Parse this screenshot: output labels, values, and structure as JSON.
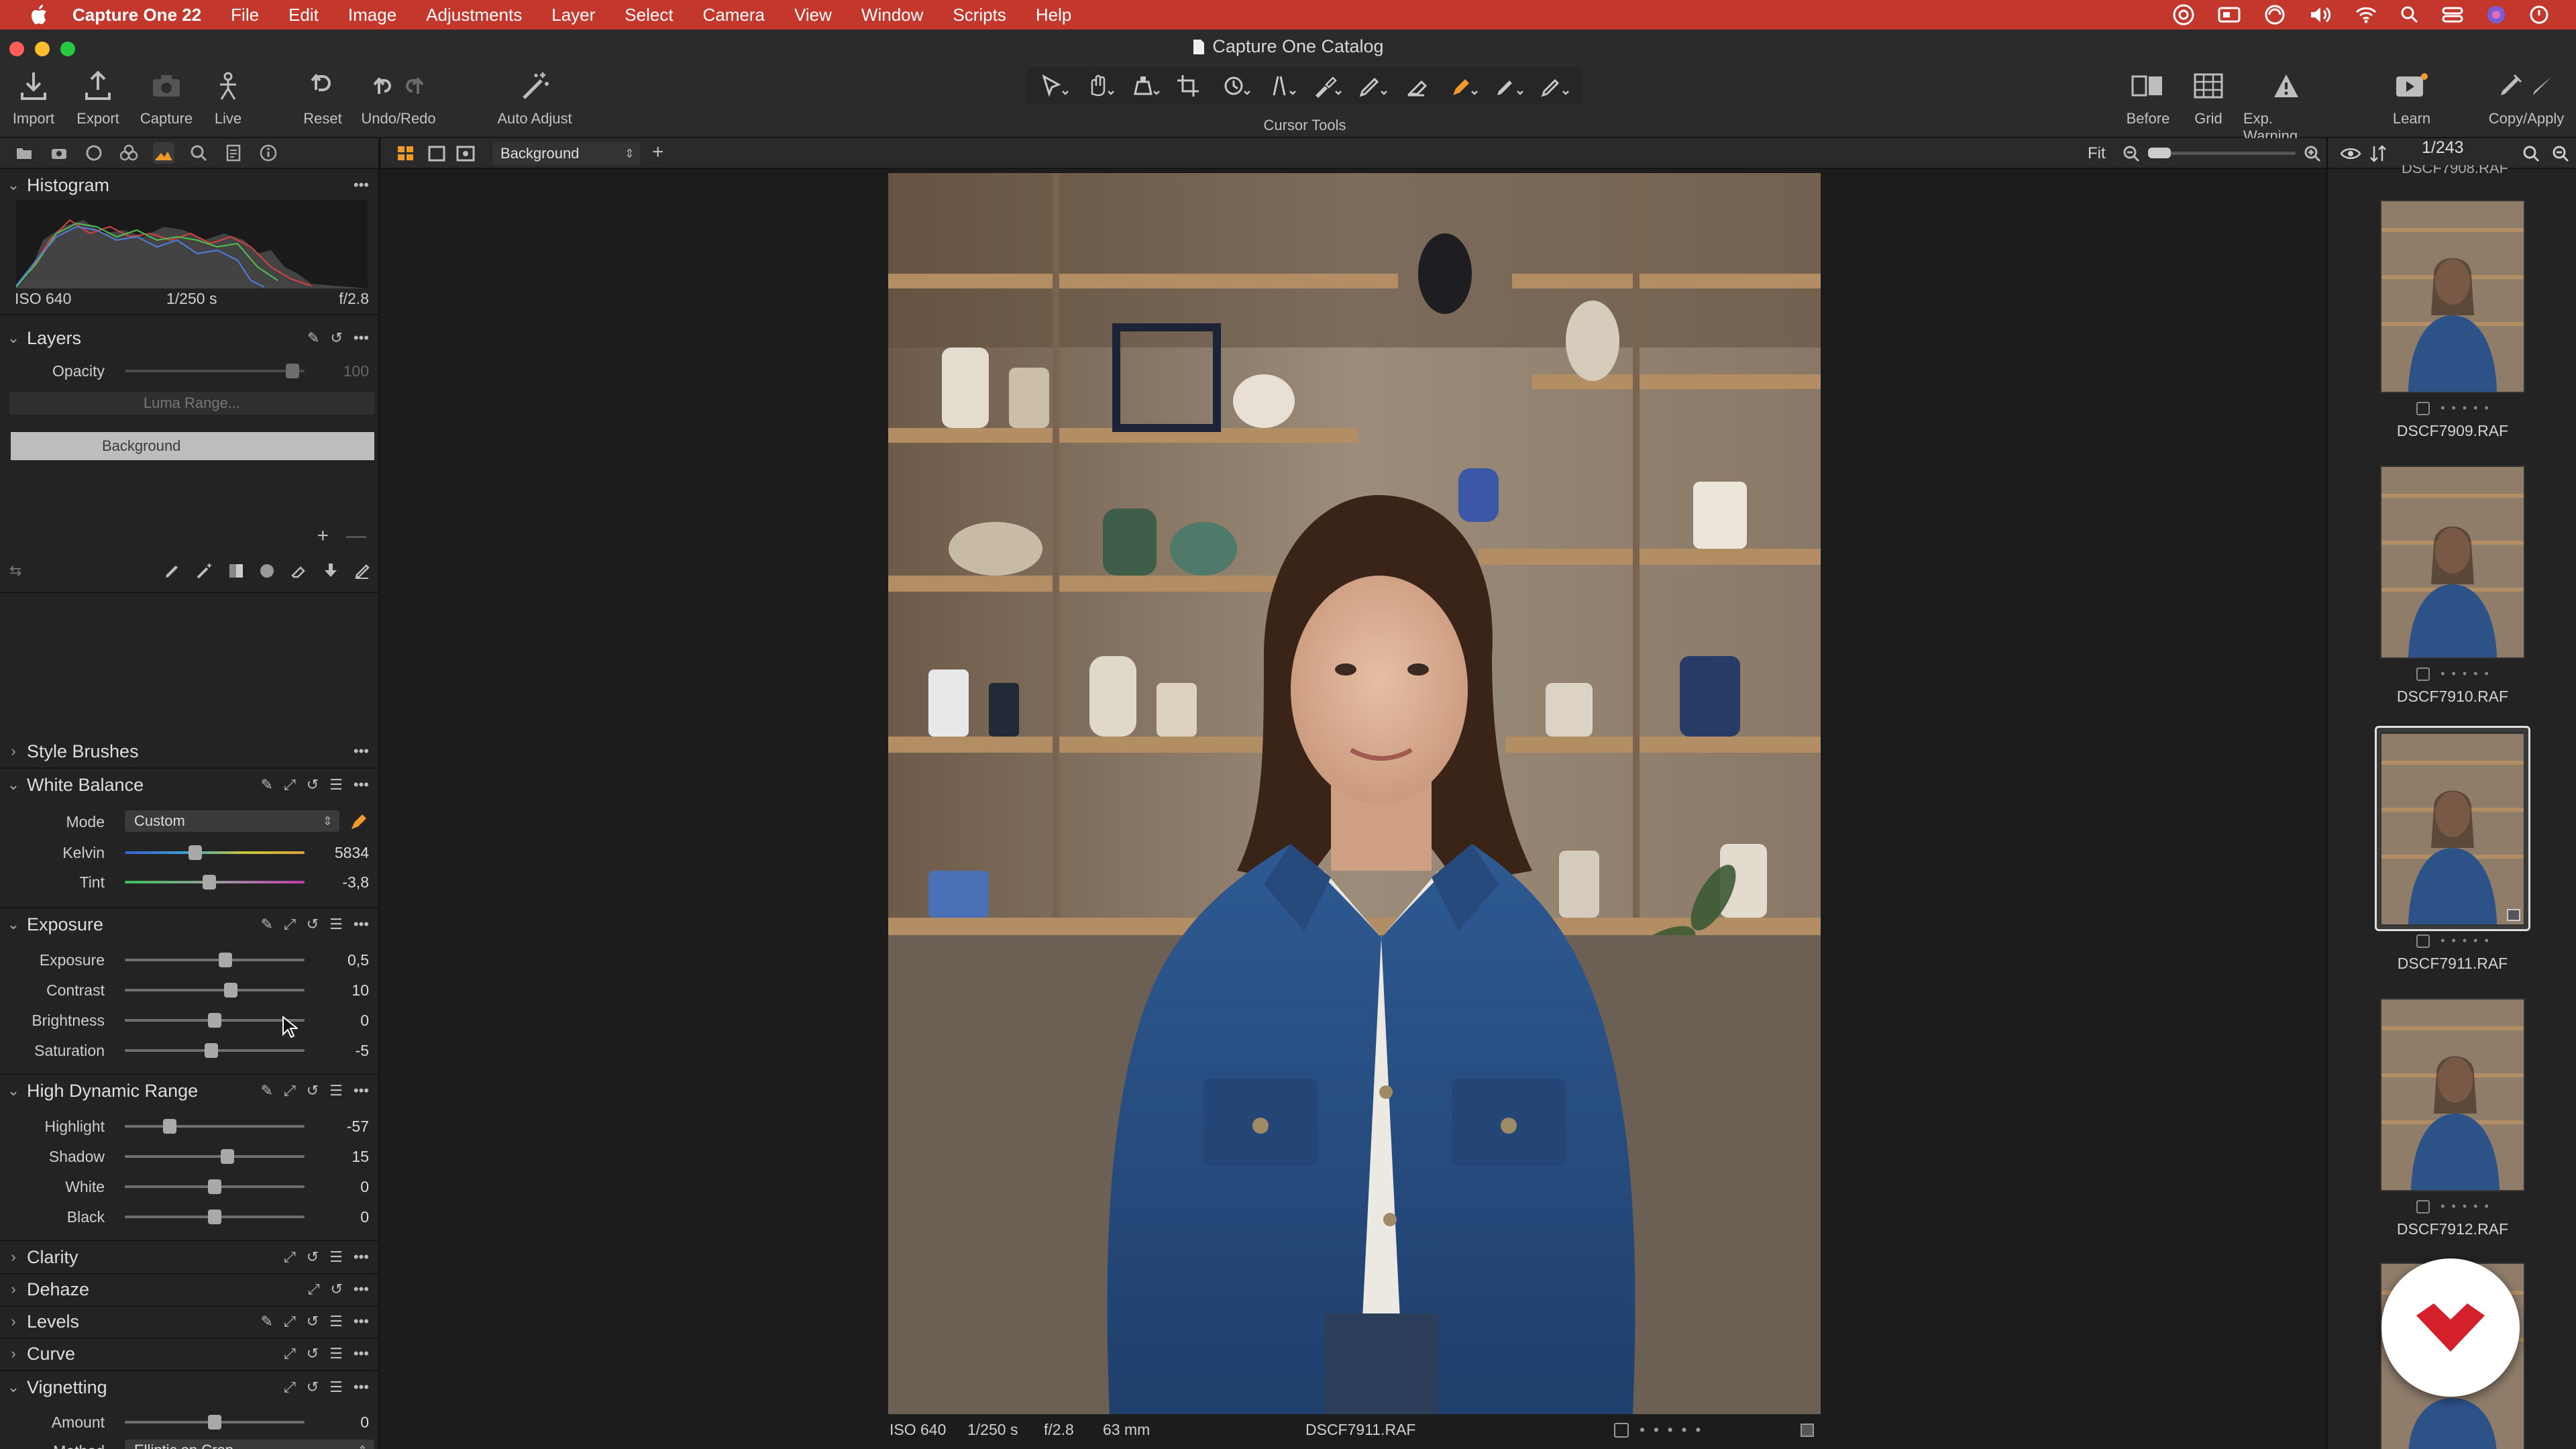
{
  "menubar": {
    "app": "Capture One 22",
    "items": [
      "File",
      "Edit",
      "Image",
      "Adjustments",
      "Layer",
      "Select",
      "Camera",
      "View",
      "Window",
      "Scripts",
      "Help"
    ]
  },
  "window": {
    "title": "Capture One Catalog"
  },
  "toolbar": {
    "import": "Import",
    "export": "Export",
    "capture": "Capture",
    "live": "Live",
    "reset": "Reset",
    "undo_redo": "Undo/Redo",
    "auto_adjust": "Auto Adjust",
    "cursor_tools": "Cursor Tools",
    "before": "Before",
    "grid": "Grid",
    "exp_warning": "Exp. Warning",
    "learn": "Learn",
    "copy_apply": "Copy/Apply"
  },
  "histogram": {
    "title": "Histogram",
    "iso": "ISO 640",
    "shutter": "1/250 s",
    "aperture": "f/2.8"
  },
  "layers": {
    "title": "Layers",
    "opacity_label": "Opacity",
    "opacity_value": "100",
    "luma_button": "Luma Range...",
    "layer_name": "Background"
  },
  "style_brushes": {
    "title": "Style Brushes"
  },
  "white_balance": {
    "title": "White Balance",
    "mode_label": "Mode",
    "mode_value": "Custom",
    "sliders": [
      {
        "label": "Kelvin",
        "value": "5834",
        "pos": 0.39
      },
      {
        "label": "Tint",
        "value": "-3,8",
        "pos": 0.47
      }
    ]
  },
  "exposure": {
    "title": "Exposure",
    "sliders": [
      {
        "label": "Exposure",
        "value": "0,5",
        "pos": 0.56
      },
      {
        "label": "Contrast",
        "value": "10",
        "pos": 0.59
      },
      {
        "label": "Brightness",
        "value": "0",
        "pos": 0.5
      },
      {
        "label": "Saturation",
        "value": "-5",
        "pos": 0.48
      }
    ]
  },
  "hdr": {
    "title": "High Dynamic Range",
    "sliders": [
      {
        "label": "Highlight",
        "value": "-57",
        "pos": 0.25
      },
      {
        "label": "Shadow",
        "value": "15",
        "pos": 0.57
      },
      {
        "label": "White",
        "value": "0",
        "pos": 0.5
      },
      {
        "label": "Black",
        "value": "0",
        "pos": 0.5
      }
    ]
  },
  "collapsed_sections": [
    "Clarity",
    "Dehaze",
    "Levels",
    "Curve"
  ],
  "vignetting": {
    "title": "Vignetting",
    "amount_label": "Amount",
    "amount_value": "0",
    "amount_pos": 0.5,
    "method_label": "Method",
    "method_value": "Elliptic on Crop"
  },
  "viewer": {
    "layer_select": "Background",
    "zoom_label": "Fit",
    "info": {
      "iso": "ISO 640",
      "shutter": "1/250 s",
      "aperture": "f/2.8",
      "focal": "63 mm",
      "filename": "DSCF7911.RAF"
    }
  },
  "browser": {
    "counter": "1/243",
    "thumbnails": [
      "DSCF7909.RAF",
      "DSCF7910.RAF",
      "DSCF7911.RAF",
      "DSCF7912.RAF"
    ],
    "selected": "DSCF7911.RAF"
  },
  "colors": {
    "menubar": "#c4372d",
    "accent_orange": "#f09a2a",
    "logo_red": "#d4202a"
  }
}
